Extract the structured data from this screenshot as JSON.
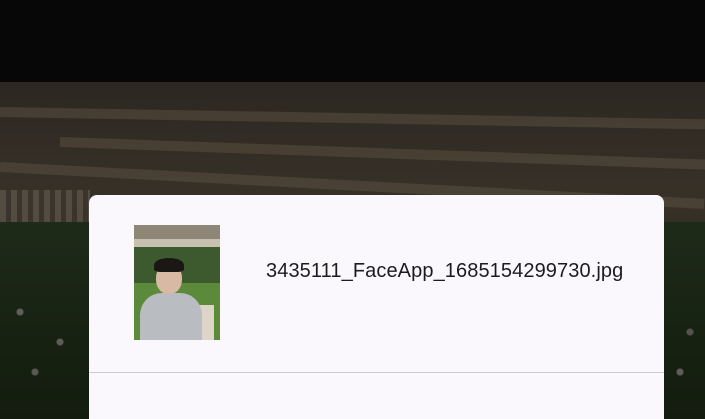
{
  "share_sheet": {
    "file_name": "3435111_FaceApp_1685154299730.jpg",
    "thumbnail_alt": "selfie photo thumbnail"
  },
  "colors": {
    "sheet_background": "#fbf8fd",
    "text": "#1c1b1f",
    "divider": "#cfcbd3"
  }
}
